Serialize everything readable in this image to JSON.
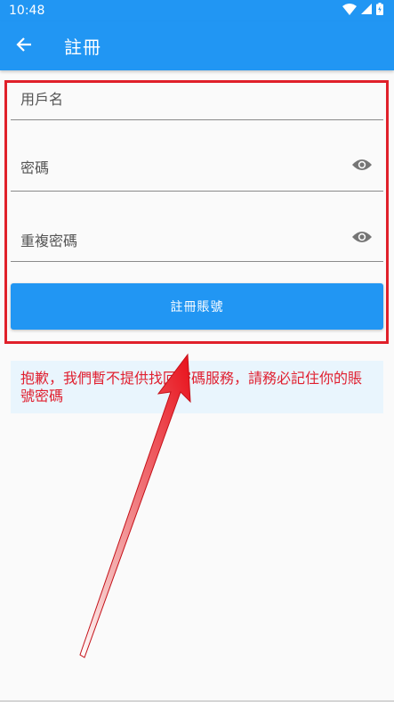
{
  "status_bar": {
    "time": "10:48"
  },
  "app_bar": {
    "title": "註冊"
  },
  "form": {
    "username_placeholder": "用戶名",
    "password_placeholder": "密碼",
    "repeat_password_placeholder": "重複密碼",
    "register_button": "註冊賬號"
  },
  "notice": {
    "text": "抱歉，我們暫不提供找回密碼服務，請務必記住你的賬號密碼"
  },
  "colors": {
    "primary": "#2196f3",
    "highlight_border": "#e0202a",
    "notice_text": "#e02030",
    "notice_bg": "#e9f5fd"
  },
  "icons": [
    "wifi-icon",
    "signal-icon",
    "battery-icon",
    "back-arrow-icon",
    "eye-icon"
  ]
}
